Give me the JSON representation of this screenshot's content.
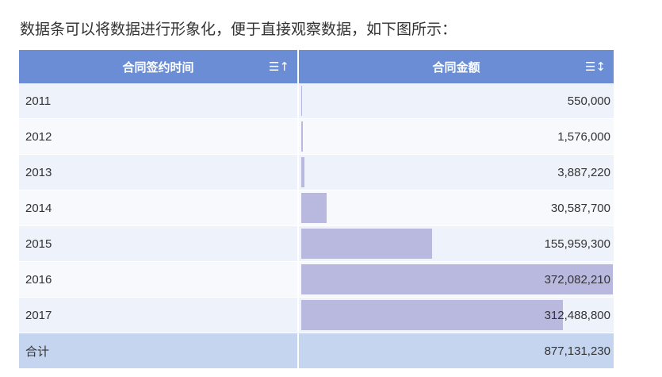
{
  "intro_text": "数据条可以将数据进行形象化，便于直接观察数据，如下图所示：",
  "table": {
    "columns": [
      {
        "label": "合同签约时间",
        "sort_icon": "sort-asc-icon"
      },
      {
        "label": "合同金额",
        "sort_icon": "sort-both-icon"
      }
    ],
    "rows": [
      {
        "year": "2011",
        "amount": "550,000",
        "amount_value": 550000
      },
      {
        "year": "2012",
        "amount": "1,576,000",
        "amount_value": 1576000
      },
      {
        "year": "2013",
        "amount": "3,887,220",
        "amount_value": 3887220
      },
      {
        "year": "2014",
        "amount": "30,587,700",
        "amount_value": 30587700
      },
      {
        "year": "2015",
        "amount": "155,959,300",
        "amount_value": 155959300
      },
      {
        "year": "2016",
        "amount": "372,082,210",
        "amount_value": 372082210
      },
      {
        "year": "2017",
        "amount": "312,488,800",
        "amount_value": 312488800
      }
    ],
    "total": {
      "label": "合计",
      "amount": "877,131,230"
    }
  },
  "colors": {
    "header_bg": "#6a8dd6",
    "bar": "#b9b9e0",
    "total_bg": "#c5d5f0"
  }
}
